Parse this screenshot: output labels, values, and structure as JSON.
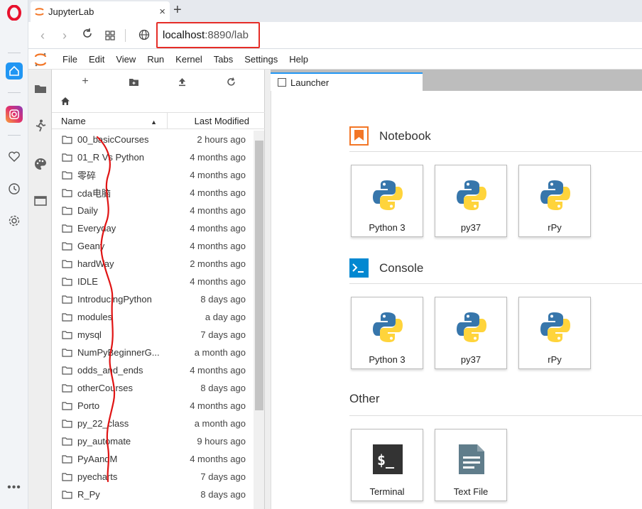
{
  "browser": {
    "tab_title": "JupyterLab",
    "tab_close": "×",
    "new_tab": "+",
    "address_host": "localhost",
    "address_rest": ":8890/lab"
  },
  "menu": [
    "File",
    "Edit",
    "View",
    "Run",
    "Kernel",
    "Tabs",
    "Settings",
    "Help"
  ],
  "filebrowser": {
    "header_name": "Name",
    "header_modified": "Last Modified",
    "rows": [
      {
        "name": "00_basicCourses",
        "modified": "2 hours ago"
      },
      {
        "name": "01_R Vs Python",
        "modified": "4 months ago"
      },
      {
        "name": "零碎",
        "modified": "4 months ago"
      },
      {
        "name": "cda电脑",
        "modified": "4 months ago"
      },
      {
        "name": "Daily",
        "modified": "4 months ago"
      },
      {
        "name": "Everyday",
        "modified": "4 months ago"
      },
      {
        "name": "Geany",
        "modified": "4 months ago"
      },
      {
        "name": "hardWay",
        "modified": "2 months ago"
      },
      {
        "name": "IDLE",
        "modified": "4 months ago"
      },
      {
        "name": "IntroducingPython",
        "modified": "8 days ago"
      },
      {
        "name": "modules",
        "modified": "a day ago"
      },
      {
        "name": "mysql",
        "modified": "7 days ago"
      },
      {
        "name": "NumPyBeginnerG...",
        "modified": "a month ago"
      },
      {
        "name": "odds_and_ends",
        "modified": "4 months ago"
      },
      {
        "name": "otherCourses",
        "modified": "8 days ago"
      },
      {
        "name": "Porto",
        "modified": "4 months ago"
      },
      {
        "name": "py_22_class",
        "modified": "a month ago"
      },
      {
        "name": "py_automate",
        "modified": "9 hours ago"
      },
      {
        "name": "PyAandM",
        "modified": "4 months ago"
      },
      {
        "name": "pyecharts",
        "modified": "7 days ago"
      },
      {
        "name": "R_Py",
        "modified": "8 days ago"
      }
    ]
  },
  "launcher": {
    "tab_label": "Launcher",
    "notebook_title": "Notebook",
    "console_title": "Console",
    "other_title": "Other",
    "notebook_cards": [
      "Python 3",
      "py37",
      "rPy"
    ],
    "console_cards": [
      "Python 3",
      "py37",
      "rPy"
    ],
    "other_cards": [
      "Terminal",
      "Text File"
    ]
  },
  "colors": {
    "accent_blue": "#2196f3",
    "annotation_red": "#e52d27",
    "notebook_orange": "#f37626",
    "console_blue": "#0288d1"
  }
}
